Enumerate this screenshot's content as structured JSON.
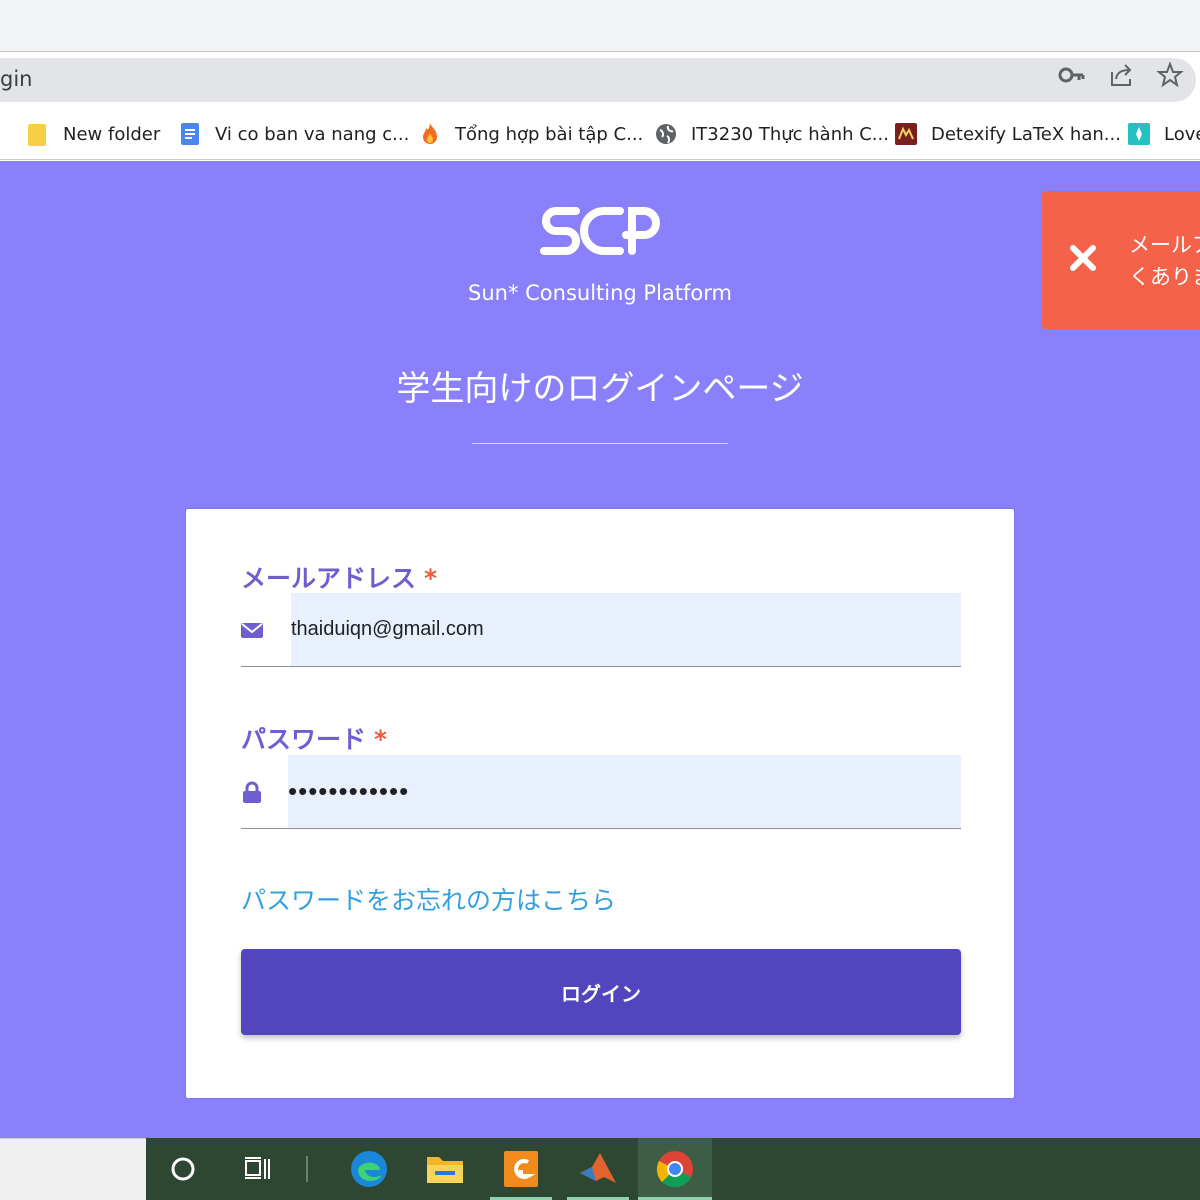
{
  "browser": {
    "address_text": "gin",
    "omnibox_icons": [
      "key-icon",
      "share-icon",
      "star-icon"
    ],
    "bookmarks": [
      {
        "label": "New folder",
        "icon": "folder-icon"
      },
      {
        "label": "Vi co ban va nang c...",
        "icon": "docs-icon"
      },
      {
        "label": "Tổng hợp bài tập C...",
        "icon": "flame-icon"
      },
      {
        "label": "IT3230 Thực hành C...",
        "icon": "globe-icon"
      },
      {
        "label": "Detexify LaTeX han...",
        "icon": "detexify-icon"
      },
      {
        "label": "Love",
        "icon": "app-icon"
      }
    ]
  },
  "page": {
    "logo_text": "SCP",
    "subtitle": "Sun* Consulting Platform",
    "title": "学生向けのログインページ",
    "colors": {
      "background": "#8b80fb",
      "toast": "#f4624a",
      "button": "#5245bd",
      "label": "#6e5fd0",
      "link": "#33a1e0",
      "required": "#f05a3c",
      "taskbar": "#2d4733"
    }
  },
  "toast": {
    "line1": "メールア",
    "line2": "くありま"
  },
  "form": {
    "email": {
      "label": "メールアドレス",
      "required_mark": "*",
      "value": "thaiduiqn@gmail.com",
      "icon": "envelope-icon"
    },
    "password": {
      "label": "パスワード",
      "required_mark": "*",
      "value": "••••••••••••",
      "icon": "lock-icon"
    },
    "forgot_link": "パスワードをお忘れの方はこちら",
    "login_button": "ログイン"
  },
  "taskbar": {
    "items": [
      "cortana-icon",
      "task-view-icon",
      "edge-icon",
      "file-explorer-icon",
      "foxit-pdf-icon",
      "matlab-icon",
      "chrome-icon"
    ]
  }
}
